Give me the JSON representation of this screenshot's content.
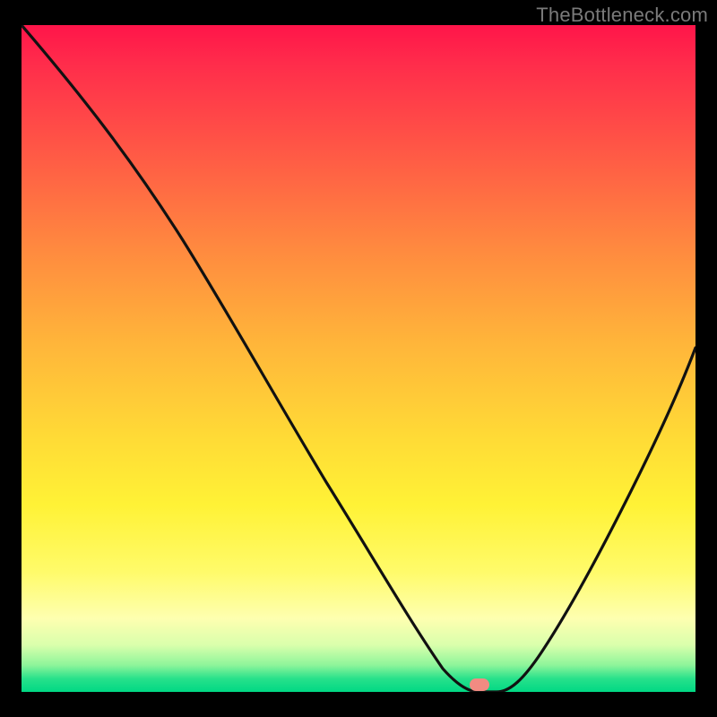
{
  "watermark": "TheBottleneck.com",
  "colors": {
    "background": "#000000",
    "curve": "#1a1a1a",
    "marker": "#f28b82"
  },
  "chart_data": {
    "type": "line",
    "title": "",
    "xlabel": "",
    "ylabel": "",
    "xlim": [
      0,
      100
    ],
    "ylim": [
      0,
      100
    ],
    "series": [
      {
        "name": "curve",
        "x": [
          0,
          6,
          12,
          18,
          24,
          30,
          36,
          42,
          48,
          54,
          60,
          63,
          66,
          70,
          76,
          82,
          88,
          94,
          100
        ],
        "y": [
          100,
          92,
          84,
          75,
          65,
          55,
          45,
          35,
          25,
          15,
          6,
          2,
          0,
          0,
          8,
          18,
          30,
          43,
          57
        ]
      }
    ],
    "marker": {
      "x": 67,
      "y": 0
    }
  }
}
